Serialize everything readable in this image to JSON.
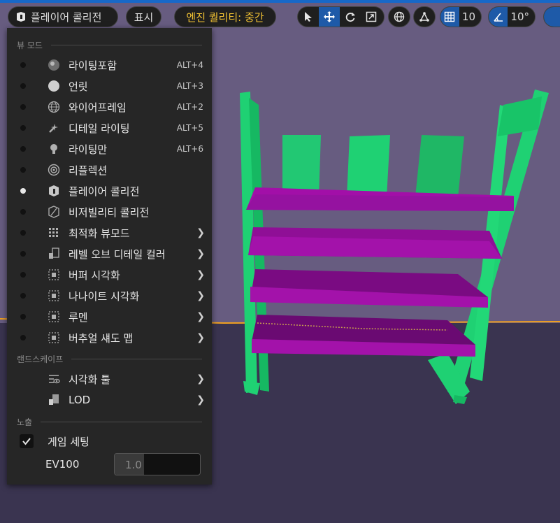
{
  "toolbar": {
    "mode_label": "플레이어 콜리전",
    "show_label": "표시",
    "quality_label": "엔진 퀄리티: 중간",
    "grid_snap_value": "10",
    "rotation_snap_value": "10°",
    "quality_color": "#f2c233"
  },
  "menu": {
    "section_viewmode": "뷰 모드",
    "section_landscape": "랜드스케이프",
    "section_exposure": "노출",
    "view_modes": [
      {
        "label": "라이팅포함",
        "shortcut": "ALT+4",
        "icon": "lit-sphere-icon",
        "selected": false
      },
      {
        "label": "언릿",
        "shortcut": "ALT+3",
        "icon": "unlit-sphere-icon",
        "selected": false
      },
      {
        "label": "와이어프레임",
        "shortcut": "ALT+2",
        "icon": "wireframe-globe-icon",
        "selected": false
      },
      {
        "label": "디테일 라이팅",
        "shortcut": "ALT+5",
        "icon": "detail-lighting-icon",
        "selected": false
      },
      {
        "label": "라이팅만",
        "shortcut": "ALT+6",
        "icon": "lightbulb-icon",
        "selected": false
      },
      {
        "label": "리플렉션",
        "shortcut": "",
        "icon": "reflection-icon",
        "selected": false
      },
      {
        "label": "플레이어 콜리전",
        "shortcut": "",
        "icon": "player-collision-icon",
        "selected": true
      },
      {
        "label": "비저빌리티 콜리전",
        "shortcut": "",
        "icon": "visibility-collision-icon",
        "selected": false
      },
      {
        "label": "최적화 뷰모드",
        "shortcut": "",
        "icon": "optimization-grid-icon",
        "selected": false,
        "submenu": true
      },
      {
        "label": "레벨 오브 디테일 컬러",
        "shortcut": "",
        "icon": "lod-coloration-icon",
        "selected": false,
        "submenu": true
      },
      {
        "label": "버퍼 시각화",
        "shortcut": "",
        "icon": "buffer-visualization-icon",
        "selected": false,
        "submenu": true
      },
      {
        "label": "나나이트 시각화",
        "shortcut": "",
        "icon": "nanite-visualization-icon",
        "selected": false,
        "submenu": true
      },
      {
        "label": "루멘",
        "shortcut": "",
        "icon": "lumen-icon",
        "selected": false,
        "submenu": true
      },
      {
        "label": "버추얼 섀도 맵",
        "shortcut": "",
        "icon": "virtual-shadow-map-icon",
        "selected": false,
        "submenu": true
      }
    ],
    "landscape_items": [
      {
        "label": "시각화 툴",
        "icon": "visualizer-tool-icon",
        "submenu": true
      },
      {
        "label": "LOD",
        "icon": "lod-icon",
        "submenu": true
      }
    ],
    "game_settings_label": "게임 세팅",
    "game_settings_checked": true,
    "ev100_label": "EV100",
    "ev100_value": "1.0"
  }
}
